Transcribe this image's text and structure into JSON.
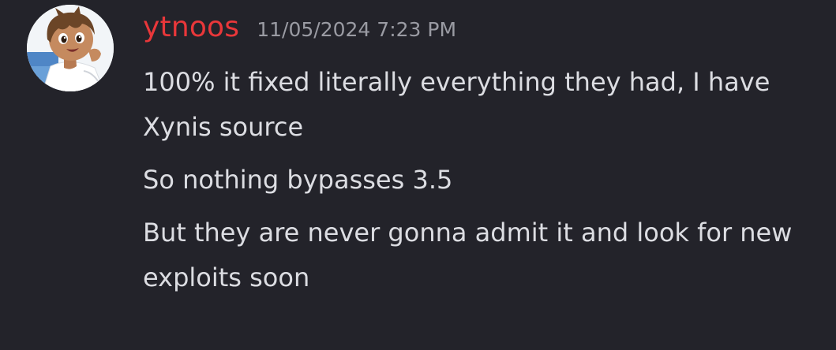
{
  "message": {
    "username": "ytnoos",
    "username_color": "#e9373a",
    "timestamp": "11/05/2024 7:23 PM",
    "avatar_icon": "anime-boy-avatar-icon",
    "paragraphs": [
      "100% it fixed literally everything they had, I have Xynis source",
      "So nothing bypasses 3.5",
      "But they are never gonna admit it and look for new exploits soon"
    ]
  },
  "colors": {
    "background": "#23232a",
    "text": "#dcdde2",
    "timestamp": "#9a9ba3"
  }
}
